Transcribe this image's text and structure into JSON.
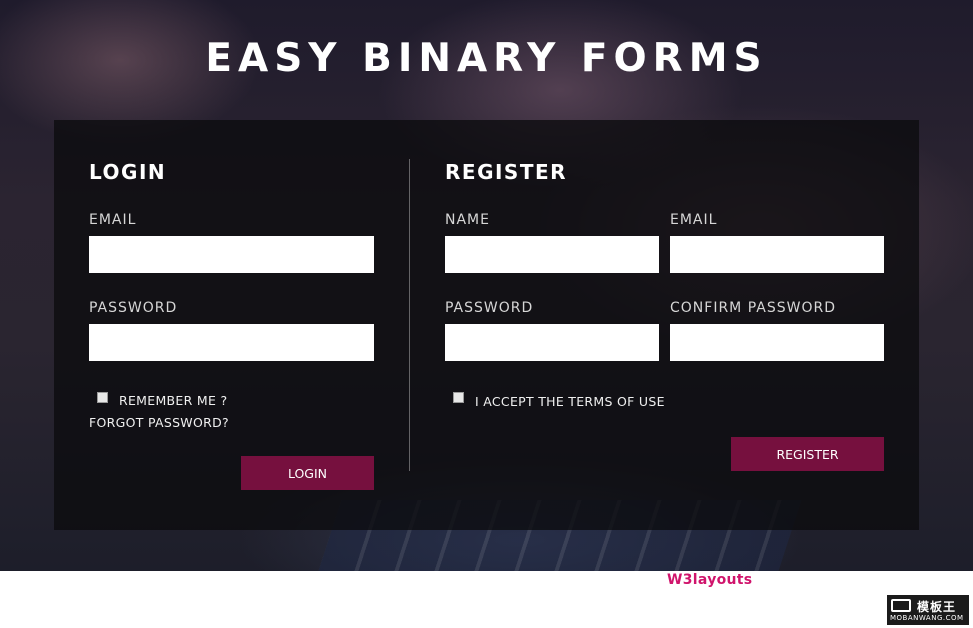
{
  "page": {
    "title": "EASY BINARY FORMS"
  },
  "login": {
    "heading": "LOGIN",
    "email_label": "EMAIL",
    "email_value": "",
    "password_label": "PASSWORD",
    "password_value": "",
    "remember_label": "REMEMBER ME ?",
    "remember_checked": false,
    "forgot_label": "FORGOT PASSWORD?",
    "button_label": "LOGIN"
  },
  "register": {
    "heading": "REGISTER",
    "name_label": "NAME",
    "name_value": "",
    "email_label": "EMAIL",
    "email_value": "",
    "password_label": "PASSWORD",
    "password_value": "",
    "confirm_label": "CONFIRM PASSWORD",
    "confirm_value": "",
    "terms_label": "I ACCEPT THE TERMS OF USE",
    "terms_checked": false,
    "button_label": "REGISTER"
  },
  "footer": {
    "credit": "W3layouts"
  },
  "watermark": {
    "name": "模板王",
    "domain": "MOBANWANG.COM",
    "icon": "stack-icon"
  },
  "colors": {
    "accent": "#76103e",
    "credit": "#d0146c"
  }
}
